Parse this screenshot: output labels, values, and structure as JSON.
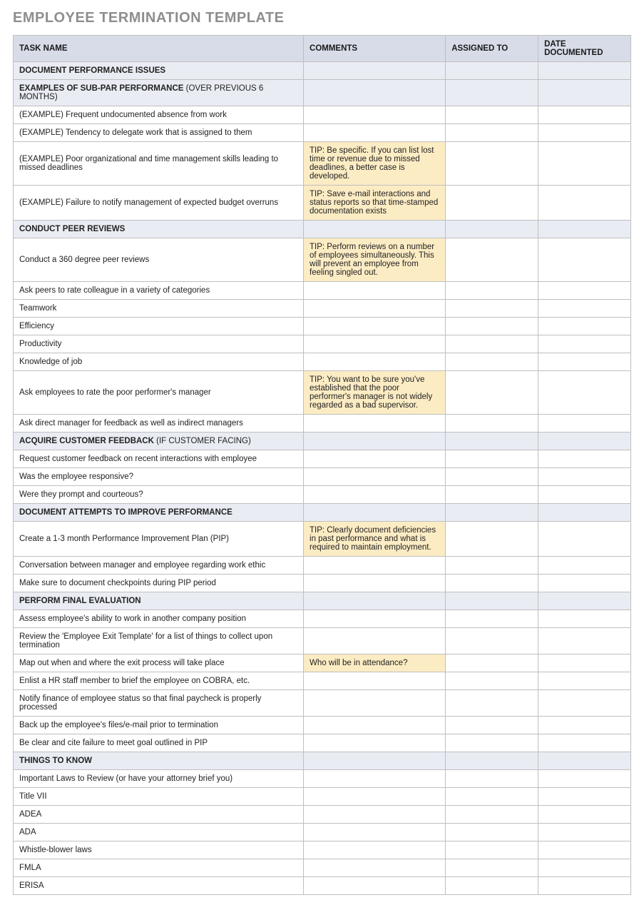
{
  "title": "EMPLOYEE TERMINATION TEMPLATE",
  "columns": [
    "TASK NAME",
    "COMMENTS",
    "ASSIGNED TO",
    "DATE DOCUMENTED"
  ],
  "rows": [
    {
      "type": "section",
      "task": "DOCUMENT PERFORMANCE ISSUES",
      "note": "",
      "comment": "",
      "tip": false
    },
    {
      "type": "section",
      "task": "EXAMPLES OF SUB-PAR PERFORMANCE",
      "note": " (OVER PREVIOUS 6 MONTHS)",
      "comment": "",
      "tip": false
    },
    {
      "type": "item",
      "task": "(EXAMPLE) Frequent undocumented absence from work",
      "comment": "",
      "tip": false
    },
    {
      "type": "item",
      "task": "(EXAMPLE) Tendency to delegate work that is assigned to them",
      "comment": "",
      "tip": false
    },
    {
      "type": "item",
      "task": "(EXAMPLE) Poor organizational and time management skills leading to missed deadlines",
      "comment": "TIP: Be specific.  If you can list lost time or revenue due to missed deadlines, a better case is developed.",
      "tip": true
    },
    {
      "type": "item",
      "task": "(EXAMPLE) Failure to notify management of expected budget overruns",
      "comment": "TIP: Save e-mail interactions and status reports so that time-stamped documentation exists",
      "tip": true
    },
    {
      "type": "section",
      "task": "CONDUCT PEER REVIEWS",
      "note": "",
      "comment": "",
      "tip": false
    },
    {
      "type": "item",
      "task": "Conduct a 360 degree peer reviews",
      "comment": "TIP: Perform reviews on a number of employees simultaneously.  This will prevent an employee from feeling singled out.",
      "tip": true
    },
    {
      "type": "item",
      "task": "Ask peers to rate colleague in a variety of categories",
      "comment": "",
      "tip": false
    },
    {
      "type": "item",
      "task": "Teamwork",
      "comment": "",
      "tip": false
    },
    {
      "type": "item",
      "task": "Efficiency",
      "comment": "",
      "tip": false
    },
    {
      "type": "item",
      "task": "Productivity",
      "comment": "",
      "tip": false
    },
    {
      "type": "item",
      "task": "Knowledge of job",
      "comment": "",
      "tip": false
    },
    {
      "type": "item",
      "task": "Ask employees to rate the poor performer's manager",
      "comment": "TIP: You want to be sure you've established that the poor performer's manager is not widely regarded as a bad supervisor.",
      "tip": true
    },
    {
      "type": "item",
      "task": "Ask direct manager for feedback as well as indirect managers",
      "comment": "",
      "tip": false
    },
    {
      "type": "section",
      "task": "ACQUIRE CUSTOMER FEEDBACK",
      "note": " (IF CUSTOMER FACING)",
      "comment": "",
      "tip": false
    },
    {
      "type": "item",
      "task": "Request customer feedback on recent interactions with employee",
      "comment": "",
      "tip": false
    },
    {
      "type": "item",
      "task": "Was the employee responsive?",
      "comment": "",
      "tip": false
    },
    {
      "type": "item",
      "task": "Were they prompt and courteous?",
      "comment": "",
      "tip": false
    },
    {
      "type": "section",
      "task": "DOCUMENT ATTEMPTS TO IMPROVE PERFORMANCE",
      "note": "",
      "comment": "",
      "tip": false
    },
    {
      "type": "item",
      "task": "Create a 1-3 month Performance Improvement Plan (PIP)",
      "comment": "TIP: Clearly document deficiencies  in past performance and what is required to maintain employment.",
      "tip": true
    },
    {
      "type": "item",
      "task": "Conversation between manager and employee regarding work ethic",
      "comment": "",
      "tip": false
    },
    {
      "type": "item",
      "task": "Make sure to document checkpoints during PIP period",
      "comment": "",
      "tip": false
    },
    {
      "type": "section",
      "task": "PERFORM FINAL EVALUATION",
      "note": "",
      "comment": "",
      "tip": false
    },
    {
      "type": "item",
      "task": "Assess employee's ability to work in another company position",
      "comment": "",
      "tip": false
    },
    {
      "type": "item",
      "task": "Review the 'Employee Exit Template' for a list of things to collect upon termination",
      "comment": "",
      "tip": false
    },
    {
      "type": "item",
      "task": "Map out when and where the exit process will take place",
      "comment": "Who will be in attendance?",
      "tip": true
    },
    {
      "type": "item",
      "task": "Enlist a HR staff member to brief the employee on COBRA, etc.",
      "comment": "",
      "tip": false
    },
    {
      "type": "item",
      "task": "Notify finance of employee status so that final paycheck is properly processed",
      "comment": "",
      "tip": false
    },
    {
      "type": "item",
      "task": "Back up the employee's files/e-mail prior to termination",
      "comment": "",
      "tip": false
    },
    {
      "type": "item",
      "task": "Be clear and cite failure to meet goal outlined in PIP",
      "comment": "",
      "tip": false
    },
    {
      "type": "section",
      "task": "THINGS TO KNOW",
      "note": "",
      "comment": "",
      "tip": false
    },
    {
      "type": "item",
      "task": "Important Laws to Review (or have your attorney brief you)",
      "comment": "",
      "tip": false
    },
    {
      "type": "item",
      "task": "Title VII",
      "comment": "",
      "tip": false
    },
    {
      "type": "item",
      "task": "ADEA",
      "comment": "",
      "tip": false
    },
    {
      "type": "item",
      "task": "ADA",
      "comment": "",
      "tip": false
    },
    {
      "type": "item",
      "task": "Whistle-blower laws",
      "comment": "",
      "tip": false
    },
    {
      "type": "item",
      "task": "FMLA",
      "comment": "",
      "tip": false
    },
    {
      "type": "item",
      "task": "ERISA",
      "comment": "",
      "tip": false
    }
  ]
}
